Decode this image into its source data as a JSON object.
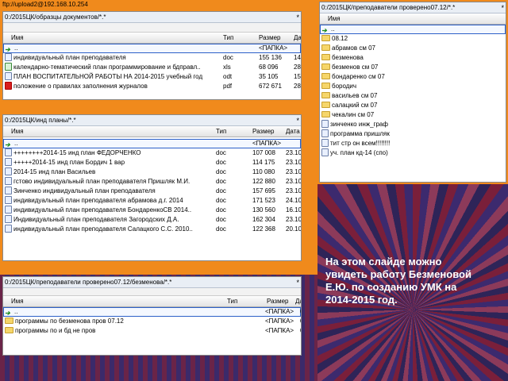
{
  "ftp_url": "ftp://upload2@192.168.10.254",
  "caption": "На этом слайде можно увидеть работу Безменовой Е.Ю. по созданию УМК на 2014-2015 год.",
  "panel1": {
    "path": "0:/2015ЦК/образцы документов/*.*",
    "ctl": "*",
    "headers": {
      "name": "Имя",
      "type": "Тип",
      "size": "Размер",
      "date": "Дат"
    },
    "rows": [
      {
        "icon": "up-arrow-icon",
        "name": "..",
        "type": "",
        "size": "<ПАПКА>",
        "date": ""
      },
      {
        "icon": "doc-icon",
        "name": "индивидуальный план преподавателя",
        "type": "doc",
        "size": "155 136",
        "date": "14"
      },
      {
        "icon": "xls-icon",
        "name": "календарно-тематический план программирование и бдправл..",
        "type": "xls",
        "size": "68 096",
        "date": "28"
      },
      {
        "icon": "doc-icon",
        "name": "ПЛАН ВОСПИТАТЕЛЬНОЙ РАБОТЫ НА 2014-2015 учебный год",
        "type": "odt",
        "size": "35 105",
        "date": "15"
      },
      {
        "icon": "pdf-icon",
        "name": "положение о правилах заполнения журналов",
        "type": "pdf",
        "size": "672 671",
        "date": "28"
      }
    ]
  },
  "panel2": {
    "path": "0:/2015ЦК/инд планы/*.*",
    "ctl": "*",
    "headers": {
      "name": "Имя",
      "type": "Тип",
      "size": "Размер",
      "date": "Дата"
    },
    "rows": [
      {
        "icon": "up-arrow-icon",
        "name": "..",
        "type": "",
        "size": "<ПАПКА>",
        "date": ""
      },
      {
        "icon": "doc-icon",
        "name": "++++++++2014-15 инд план ФЕДОРЧЕНКО",
        "type": "doc",
        "size": "107 008",
        "date": "23.10"
      },
      {
        "icon": "doc-icon",
        "name": "+++++2014-15 инд план Бордич 1 вар",
        "type": "doc",
        "size": "114 175",
        "date": "23.10"
      },
      {
        "icon": "doc-icon",
        "name": "2014-15 инд план Васильев",
        "type": "doc",
        "size": "110 080",
        "date": "23.10"
      },
      {
        "icon": "doc-icon",
        "name": "гстово индивидуальный план преподавателя Пришляк М.И.",
        "type": "doc",
        "size": "122 880",
        "date": "23.10"
      },
      {
        "icon": "doc-icon",
        "name": "Зинченко индивидуальный план преподавателя",
        "type": "doc",
        "size": "157 695",
        "date": "23.10"
      },
      {
        "icon": "doc-icon",
        "name": "индивидуальный план преподавателя абрамова д.г. 2014",
        "type": "doc",
        "size": "171 523",
        "date": "24.10"
      },
      {
        "icon": "doc-icon",
        "name": "индивидуальный план преподавателя БондаренкоСВ 2014..",
        "type": "doc",
        "size": "130 560",
        "date": "16.10"
      },
      {
        "icon": "doc-icon",
        "name": "Индивидуальный план преподавателя Загородских Д.А.",
        "type": "doc",
        "size": "162 304",
        "date": "23.10"
      },
      {
        "icon": "doc-icon",
        "name": "индивидуальный план преподавателя Салацкого С.С. 2010..",
        "type": "doc",
        "size": "122 368",
        "date": "20.10"
      }
    ]
  },
  "panel3": {
    "path": "0:/2015ЦК/преподаватели проверено07.12/безменова/*.*",
    "ctl": "*",
    "headers": {
      "name": "Имя",
      "type": "Тип",
      "size": "Размер",
      "date": "Да"
    },
    "rows": [
      {
        "icon": "up-arrow-icon",
        "name": "..",
        "type": "",
        "size": "<ПАПКА>",
        "date": "0"
      },
      {
        "icon": "folder-icon",
        "name": "программы по безменова пров 07.12",
        "type": "",
        "size": "<ПАПКА>",
        "date": "0"
      },
      {
        "icon": "folder-icon",
        "name": "программы по и бд не пров",
        "type": "",
        "size": "<ПАПКА>",
        "date": "0"
      }
    ]
  },
  "panel4": {
    "path": "0:/2015ЦК/преподаватели проверено07.12/*.*",
    "ctl": "*",
    "headers": {
      "name": "Имя"
    },
    "rows": [
      {
        "icon": "up-arrow-icon",
        "name": ".."
      },
      {
        "icon": "folder-icon",
        "name": "08.12"
      },
      {
        "icon": "folder-icon",
        "name": "абрамов см 07"
      },
      {
        "icon": "folder-icon",
        "name": "безменова"
      },
      {
        "icon": "folder-icon",
        "name": "безменов см 07"
      },
      {
        "icon": "folder-icon",
        "name": "бондаренко см 07"
      },
      {
        "icon": "folder-icon",
        "name": "бородич"
      },
      {
        "icon": "folder-icon",
        "name": "васильев см 07"
      },
      {
        "icon": "folder-icon",
        "name": "салацкий см 07"
      },
      {
        "icon": "folder-icon",
        "name": "чекалин см 07"
      },
      {
        "icon": "doc-icon",
        "name": "зинченко инж_граф"
      },
      {
        "icon": "doc-icon",
        "name": "программа пришляк"
      },
      {
        "icon": "doc-icon",
        "name": "тит стр он всем!!!!!!!!"
      },
      {
        "icon": "doc-icon",
        "name": "уч. план кд-14 (спо)"
      }
    ]
  }
}
